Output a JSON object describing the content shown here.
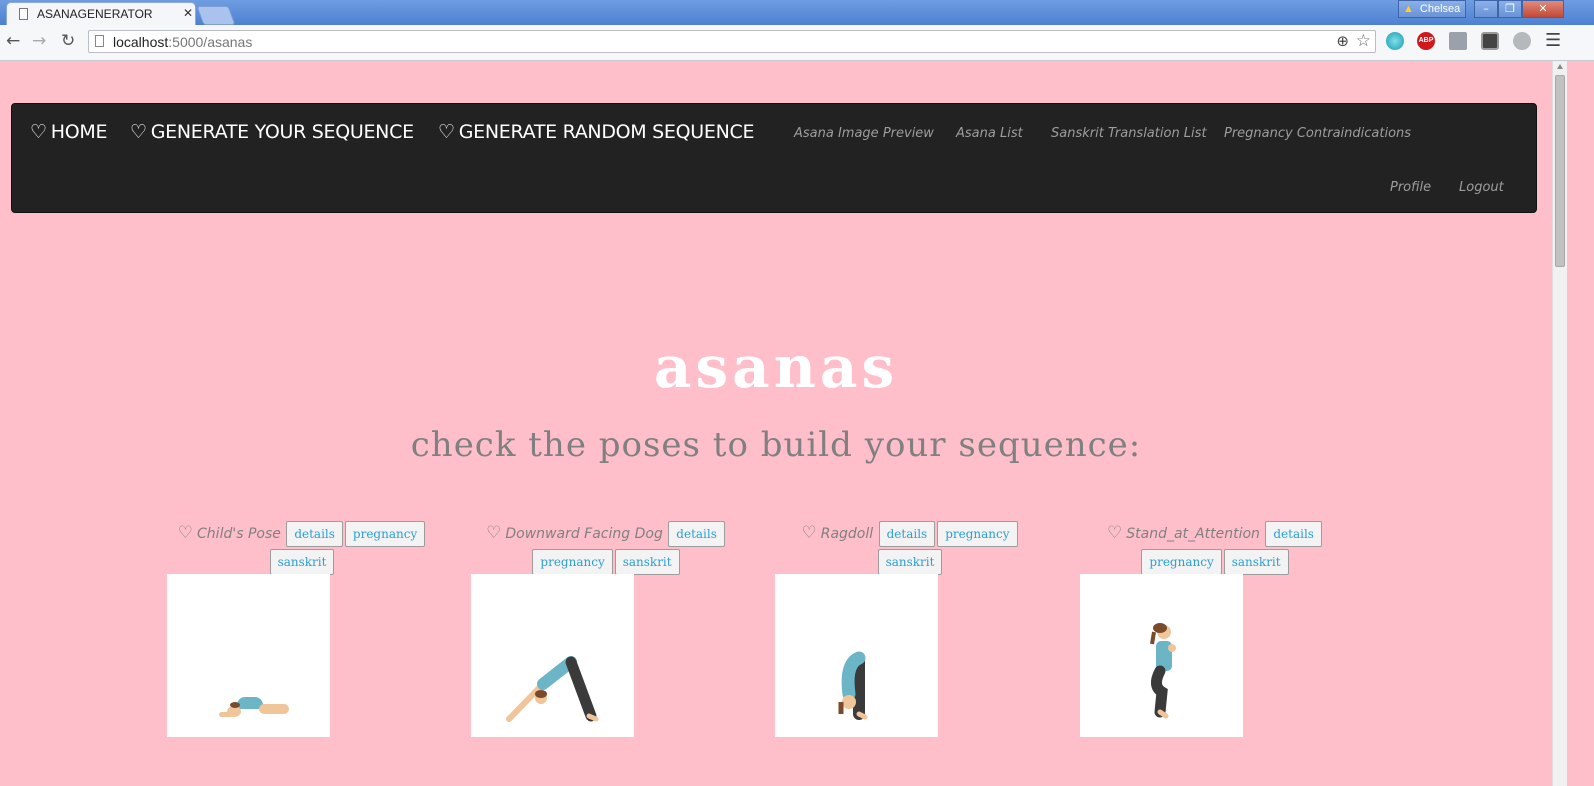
{
  "browser": {
    "tab_title": "ASANAGENERATOR",
    "url_host": "localhost",
    "url_path": ":5000/asanas",
    "profile_name": "Chelsea",
    "ext_abp": "ABP"
  },
  "nav": {
    "main": [
      "HOME",
      "GENERATE YOUR SEQUENCE",
      "GENERATE RANDOM SEQUENCE"
    ],
    "secondary": [
      "Asana Image Preview",
      "Asana List",
      "Sanskrit Translation List",
      "Pregnancy Contraindications"
    ],
    "account": [
      "Profile",
      "Logout"
    ]
  },
  "page": {
    "title": "asanas",
    "subtitle": "check the poses to build your sequence:"
  },
  "buttons": {
    "details": "details",
    "pregnancy": "pregnancy",
    "sanskrit": "sanskrit"
  },
  "poses": [
    {
      "name": "Child's Pose"
    },
    {
      "name": "Downward Facing Dog"
    },
    {
      "name": "Ragdoll"
    },
    {
      "name": "Stand_at_Attention"
    }
  ],
  "colors": {
    "page_bg": "#ffbfca",
    "navbar_bg": "#222222",
    "button_text": "#2a9fd6",
    "muted_text": "#808080"
  },
  "icons": {
    "heart": "heart-outline-icon"
  }
}
